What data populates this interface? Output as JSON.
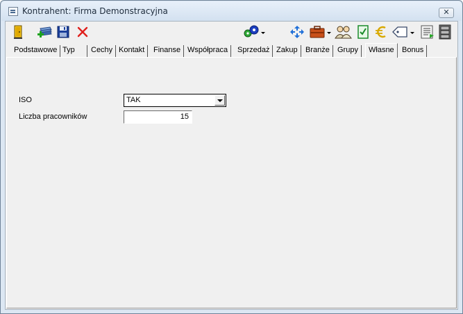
{
  "window": {
    "title": "Kontrahent: Firma Demonstracyjna",
    "close_label": "✕"
  },
  "toolbar": {
    "icons": [
      "door-icon",
      "add-to-list-icon",
      "save-icon",
      "delete-icon",
      "gears-icon",
      "arrows-in-icon",
      "briefcase-icon",
      "people-icon",
      "checklist-icon",
      "euro-icon",
      "tag-icon",
      "list-icon",
      "cabinet-icon"
    ]
  },
  "tabs": [
    {
      "label": "Podstawowe"
    },
    {
      "label": "Typ"
    },
    {
      "label": "Cechy"
    },
    {
      "label": "Kontakt"
    },
    {
      "label": "Finanse"
    },
    {
      "label": "Współpraca"
    },
    {
      "label": "Sprzedaż"
    },
    {
      "label": "Zakup"
    },
    {
      "label": "Branże"
    },
    {
      "label": "Grupy"
    },
    {
      "label": "Własne",
      "active": true
    },
    {
      "label": "Bonus"
    }
  ],
  "form": {
    "iso_label": "ISO",
    "iso_value": "TAK",
    "employees_label": "Liczba pracowników",
    "employees_value": "15"
  },
  "colors": {
    "window_frame": "#dce7f3",
    "client_bg": "#f0f0f0",
    "delete_red": "#e0201c",
    "save_blue": "#1a3f9a"
  }
}
